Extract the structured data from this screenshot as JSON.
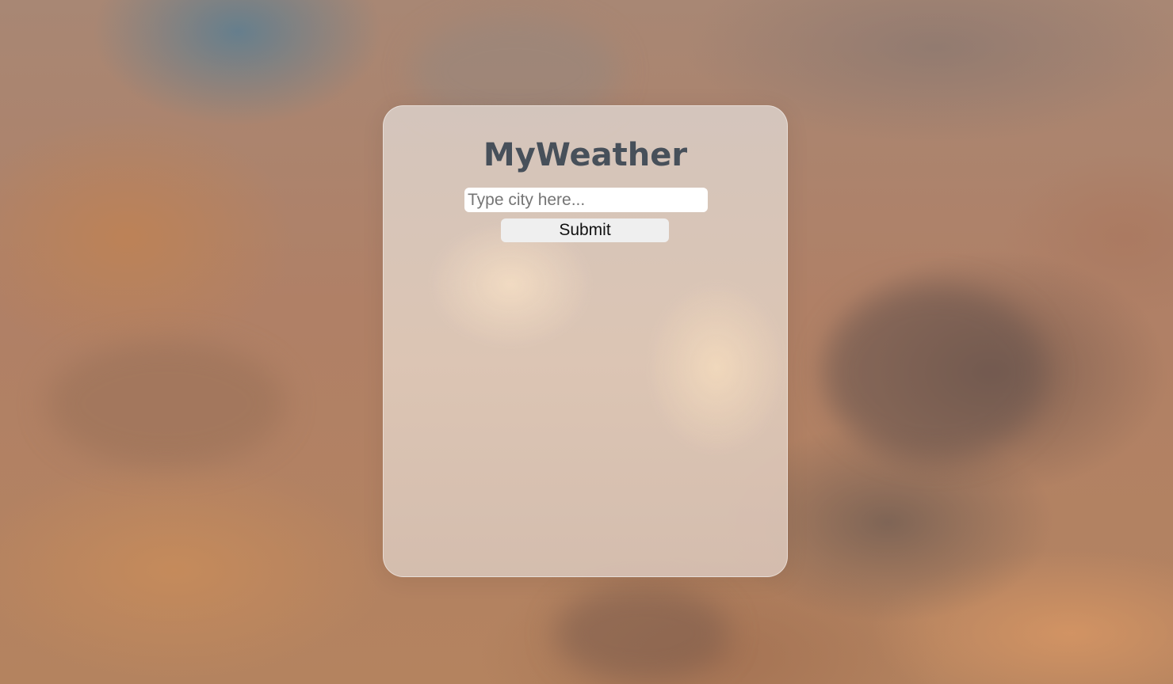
{
  "app": {
    "title": "MyWeather"
  },
  "search": {
    "value": "",
    "placeholder": "Type city here...",
    "submit_label": "Submit"
  },
  "colors": {
    "title_text": "#47505a",
    "card_tint": "#d8c6ba",
    "button_bg": "#efefef",
    "input_bg": "#ffffff"
  }
}
